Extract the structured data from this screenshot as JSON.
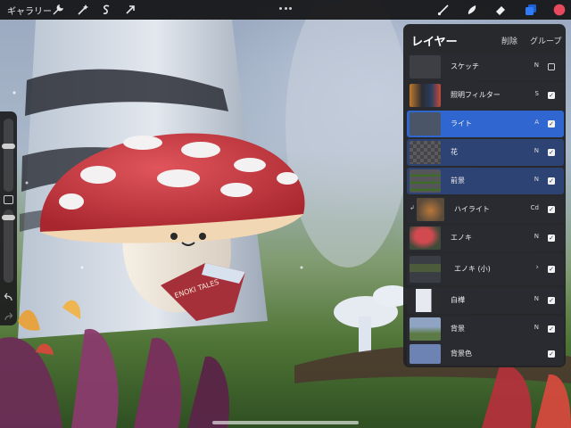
{
  "toolbar": {
    "gallery_label": "ギャラリー",
    "left_tools": [
      "wrench-icon",
      "magic-wand-icon",
      "selection-icon",
      "transform-arrow-icon"
    ],
    "right_tools": [
      "brush-icon",
      "smudge-icon",
      "eraser-icon",
      "layers-icon",
      "color-swatch-icon"
    ],
    "color_swatch": "#e9495d",
    "accent": "#2f6fe0"
  },
  "layers": {
    "title": "レイヤー",
    "delete_label": "削除",
    "group_label": "グループ",
    "items": [
      {
        "name": "スケッチ",
        "blend": "N",
        "visible": false,
        "state": "normal"
      },
      {
        "name": "照明フィルター",
        "blend": "S",
        "visible": true,
        "state": "normal"
      },
      {
        "name": "ライト",
        "blend": "A",
        "visible": true,
        "state": "selected"
      },
      {
        "name": "花",
        "blend": "N",
        "visible": true,
        "state": "secondary"
      },
      {
        "name": "前景",
        "blend": "N",
        "visible": true,
        "state": "secondary"
      },
      {
        "name": "ハイライト",
        "blend": "Cd",
        "visible": true,
        "state": "normal"
      },
      {
        "name": "エノキ",
        "blend": "N",
        "visible": true,
        "state": "normal"
      },
      {
        "name": "エノキ (小)",
        "blend": "",
        "visible": true,
        "state": "group"
      },
      {
        "name": "白樺",
        "blend": "N",
        "visible": true,
        "state": "normal"
      },
      {
        "name": "背景",
        "blend": "N",
        "visible": true,
        "state": "normal"
      },
      {
        "name": "背景色",
        "blend": "",
        "visible": true,
        "state": "normal"
      }
    ]
  },
  "canvas": {
    "book_title": "ENOKI TALES"
  }
}
